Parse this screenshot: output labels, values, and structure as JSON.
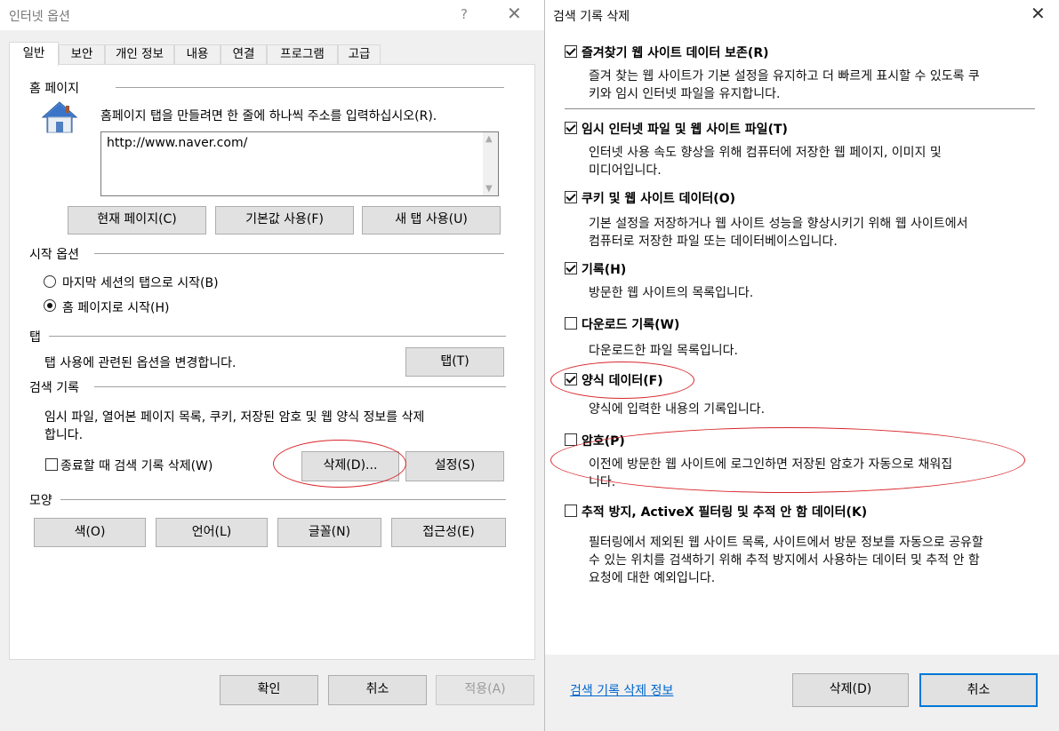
{
  "internet_options": {
    "title": "인터넷 옵션",
    "help_icon": "?",
    "close_icon": "✕",
    "tabs": [
      "일반",
      "보안",
      "개인 정보",
      "내용",
      "연결",
      "프로그램",
      "고급"
    ],
    "homepage": {
      "heading": "홈 페이지",
      "description": "홈페이지 탭을 만들려면 한 줄에 하나씩 주소를 입력하십시오(R).",
      "value": "http://www.naver.com/",
      "buttons": [
        "현재 페이지(C)",
        "기본값 사용(F)",
        "새 탭 사용(U)"
      ]
    },
    "startup": {
      "heading": "시작 옵션",
      "options": [
        "마지막 세션의 탭으로 시작(B)",
        "홈 페이지로 시작(H)"
      ],
      "selected_index": 1
    },
    "tabs_section": {
      "heading": "탭",
      "description": "탭 사용에 관련된 옵션을 변경합니다.",
      "button": "탭(T)"
    },
    "history": {
      "heading": "검색 기록",
      "description_line1": "임시 파일, 열어본 페이지 목록, 쿠키, 저장된 암호 및 웹 양식 정보를 삭제",
      "description_line2": "합니다.",
      "checkbox_label": "종료할 때 검색 기록 삭제(W)",
      "checkbox_checked": false,
      "delete_button": "삭제(D)...",
      "settings_button": "설정(S)"
    },
    "appearance": {
      "heading": "모양",
      "buttons": [
        "색(O)",
        "언어(L)",
        "글꼴(N)",
        "접근성(E)"
      ]
    },
    "footer": {
      "ok": "확인",
      "cancel": "취소",
      "apply": "적용(A)"
    }
  },
  "delete_history": {
    "title": "검색 기록 삭제",
    "close_icon": "✕",
    "options": [
      {
        "label": "즐겨찾기 웹 사이트 데이터 보존(R)",
        "checked": true,
        "desc": [
          "즐겨 찾는 웹 사이트가 기본 설정을 유지하고 더 빠르게 표시할 수 있도록 쿠",
          "키와 임시 인터넷 파일을 유지합니다."
        ]
      },
      {
        "label": "임시 인터넷 파일 및 웹 사이트 파일(T)",
        "checked": true,
        "desc": [
          "인터넷 사용 속도 향상을 위해 컴퓨터에 저장한 웹 페이지, 이미지 및",
          "미디어입니다."
        ]
      },
      {
        "label": "쿠키 및 웹 사이트 데이터(O)",
        "checked": true,
        "desc": [
          "기본 설정을 저장하거나 웹 사이트 성능을 향상시키기 위해 웹 사이트에서",
          "컴퓨터로 저장한 파일 또는 데이터베이스입니다."
        ]
      },
      {
        "label": "기록(H)",
        "checked": true,
        "desc": [
          "방문한 웹 사이트의 목록입니다."
        ]
      },
      {
        "label": "다운로드 기록(W)",
        "checked": false,
        "desc": [
          "다운로드한 파일 목록입니다."
        ]
      },
      {
        "label": "양식 데이터(F)",
        "checked": true,
        "desc": [
          "양식에 입력한 내용의 기록입니다."
        ]
      },
      {
        "label": "암호(P)",
        "checked": false,
        "desc": [
          "이전에 방문한 웹 사이트에 로그인하면 저장된 암호가 자동으로 채워집",
          "니다."
        ]
      },
      {
        "label": "추적 방지, ActiveX 필터링 및 추적 안 함 데이터(K)",
        "checked": false,
        "desc": [
          "필터링에서 제외된 웹 사이트 목록, 사이트에서 방문 정보를 자동으로 공유할",
          "수 있는 위치를 검색하기 위해 추적 방지에서 사용하는 데이터 및 추적 안 함",
          "요청에 대한 예외입니다."
        ]
      }
    ],
    "footer": {
      "link": "검색 기록 삭제 정보",
      "delete": "삭제(D)",
      "cancel": "취소"
    }
  },
  "colors": {
    "annotation_ring": "#d9252a",
    "link": "#0066cc",
    "focus_border": "#0078d7"
  }
}
